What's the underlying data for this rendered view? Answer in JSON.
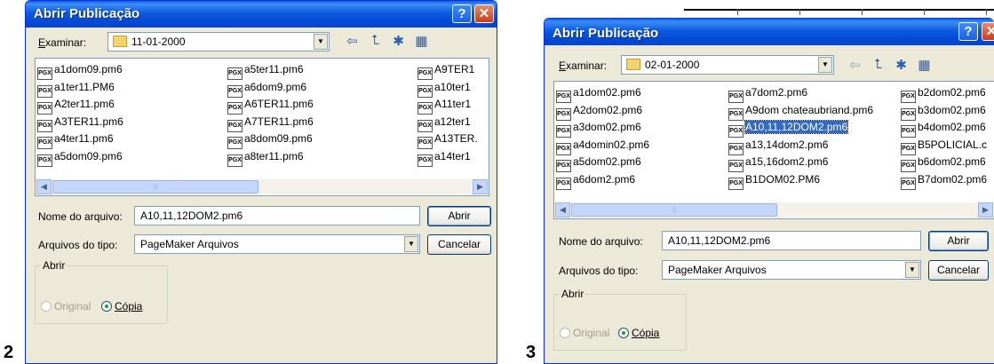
{
  "figures": [
    "2",
    "3"
  ],
  "dialogs": [
    {
      "title": "Abrir Publicação",
      "examinar_label": "Examinar:",
      "folder": "11-01-2000",
      "columns": [
        [
          "a1dom09.pm6",
          "a1ter11.PM6",
          "A2ter11.pm6",
          "A3TER11.pm6",
          "a4ter11.pm6",
          "a5dom09.pm6"
        ],
        [
          "a5ter11.pm6",
          "a6dom9.pm6",
          "A6TER11.pm6",
          "A7TER11.pm6",
          "a8dom09.pm6",
          "a8ter11.pm6"
        ],
        [
          "A9TER1",
          "a10ter1",
          "A11ter1",
          "a12ter1",
          "A13TER.",
          "a14ter1"
        ]
      ],
      "selected": "",
      "filename_label": "Nome do arquivo:",
      "filename_value": "A10,11,12DOM2.pm6",
      "filetype_label": "Arquivos do tipo:",
      "filetype_value": "PageMaker Arquivos",
      "open_button": "Abrir",
      "cancel_button": "Cancelar",
      "group_label": "Abrir",
      "radio_original": "Original",
      "radio_copy": "Cópia"
    },
    {
      "title": "Abrir Publicação",
      "examinar_label": "Examinar:",
      "folder": "02-01-2000",
      "columns": [
        [
          "a1dom02.pm6",
          "A2dom02.pm6",
          "a3dom02.pm6",
          "a4domin02.pm6",
          "a5dom02.pm6",
          "a6dom2.pm6"
        ],
        [
          "a7dom2.pm6",
          "A9dom chateaubriand.pm6",
          "A10,11,12DOM2.pm6",
          "a13,14dom2.pm6",
          "a15,16dom2.pm6",
          "B1DOM02.PM6"
        ],
        [
          "b2dom02.pm6",
          "b3dom02.pm6",
          "b4dom02.pm6",
          "B5POLICIAL.c",
          "b6dom02.pm6",
          "B7dom02.pm6"
        ]
      ],
      "selected": "A10,11,12DOM2.pm6",
      "filename_label": "Nome do arquivo:",
      "filename_value": "A10,11,12DOM2.pm6",
      "filetype_label": "Arquivos do tipo:",
      "filetype_value": "PageMaker Arquivos",
      "open_button": "Abrir",
      "cancel_button": "Cancelar",
      "group_label": "Abrir",
      "radio_original": "Original",
      "radio_copy": "Cópia"
    }
  ],
  "file_icon_label": "PGX",
  "icons": [
    "help-icon",
    "close-icon",
    "folder-icon",
    "back-arrow-icon",
    "up-folder-icon",
    "new-folder-icon",
    "view-menu-icon",
    "pagemaker-file-icon"
  ]
}
